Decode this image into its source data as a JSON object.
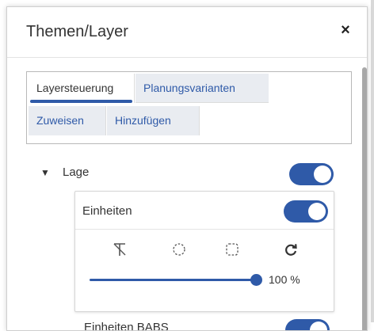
{
  "panel": {
    "title": "Themen/Layer",
    "close_symbol": "×"
  },
  "tabs": [
    {
      "label": "Layersteuerung",
      "active": true
    },
    {
      "label": "Planungsvarianten",
      "active": false
    },
    {
      "label": "Zuweisen",
      "active": false
    },
    {
      "label": "Hinzufügen",
      "active": false
    }
  ],
  "layer_group": {
    "caret": "▼",
    "label": "Lage",
    "enabled": true
  },
  "layer": {
    "label": "Einheiten",
    "enabled": true,
    "tools": [
      "strikethrough-t-icon",
      "circle-select-icon",
      "rect-select-icon",
      "refresh-icon"
    ],
    "opacity_value": 1.0,
    "opacity_label": "100 %"
  },
  "next_layer": {
    "label": "Einheiten BABS",
    "enabled": true
  },
  "colors": {
    "accent": "#2f5aa8",
    "tab_inactive_bg": "#e9ecf1"
  }
}
